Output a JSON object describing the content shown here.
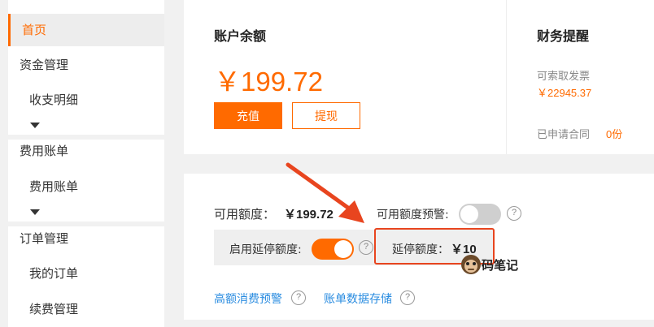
{
  "sidebar": {
    "items": [
      {
        "label": "首页",
        "active": true
      },
      {
        "label": "资金管理"
      },
      {
        "label": "收支明细"
      },
      {
        "label": "费用账单"
      },
      {
        "label": "费用账单"
      },
      {
        "label": "订单管理"
      },
      {
        "label": "我的订单"
      },
      {
        "label": "续费管理"
      }
    ]
  },
  "balance": {
    "title": "账户余额",
    "amount": "￥199.72",
    "recharge_label": "充值",
    "withdraw_label": "提现"
  },
  "finance": {
    "title": "财务提醒",
    "invoice_label": "可索取发票",
    "invoice_value": "￥22945.37",
    "contract_label": "已申请合同",
    "contract_value": "0份"
  },
  "quota": {
    "available_label": "可用额度：",
    "available_amount": "￥199.72",
    "warning_label": "可用额度预警:",
    "warning_enabled": false,
    "deferred_enable_label": "启用延停额度:",
    "deferred_enabled": true,
    "deferred_label": "延停额度：",
    "deferred_amount": "￥10",
    "help_glyph": "?",
    "high_consumption_link": "高额消费预警",
    "bill_storage_link": "账单数据存储"
  },
  "watermark": {
    "text": "码笔记"
  },
  "colors": {
    "accent": "#ff6a00",
    "link": "#2a8ce0",
    "annotation": "#e8451f"
  }
}
